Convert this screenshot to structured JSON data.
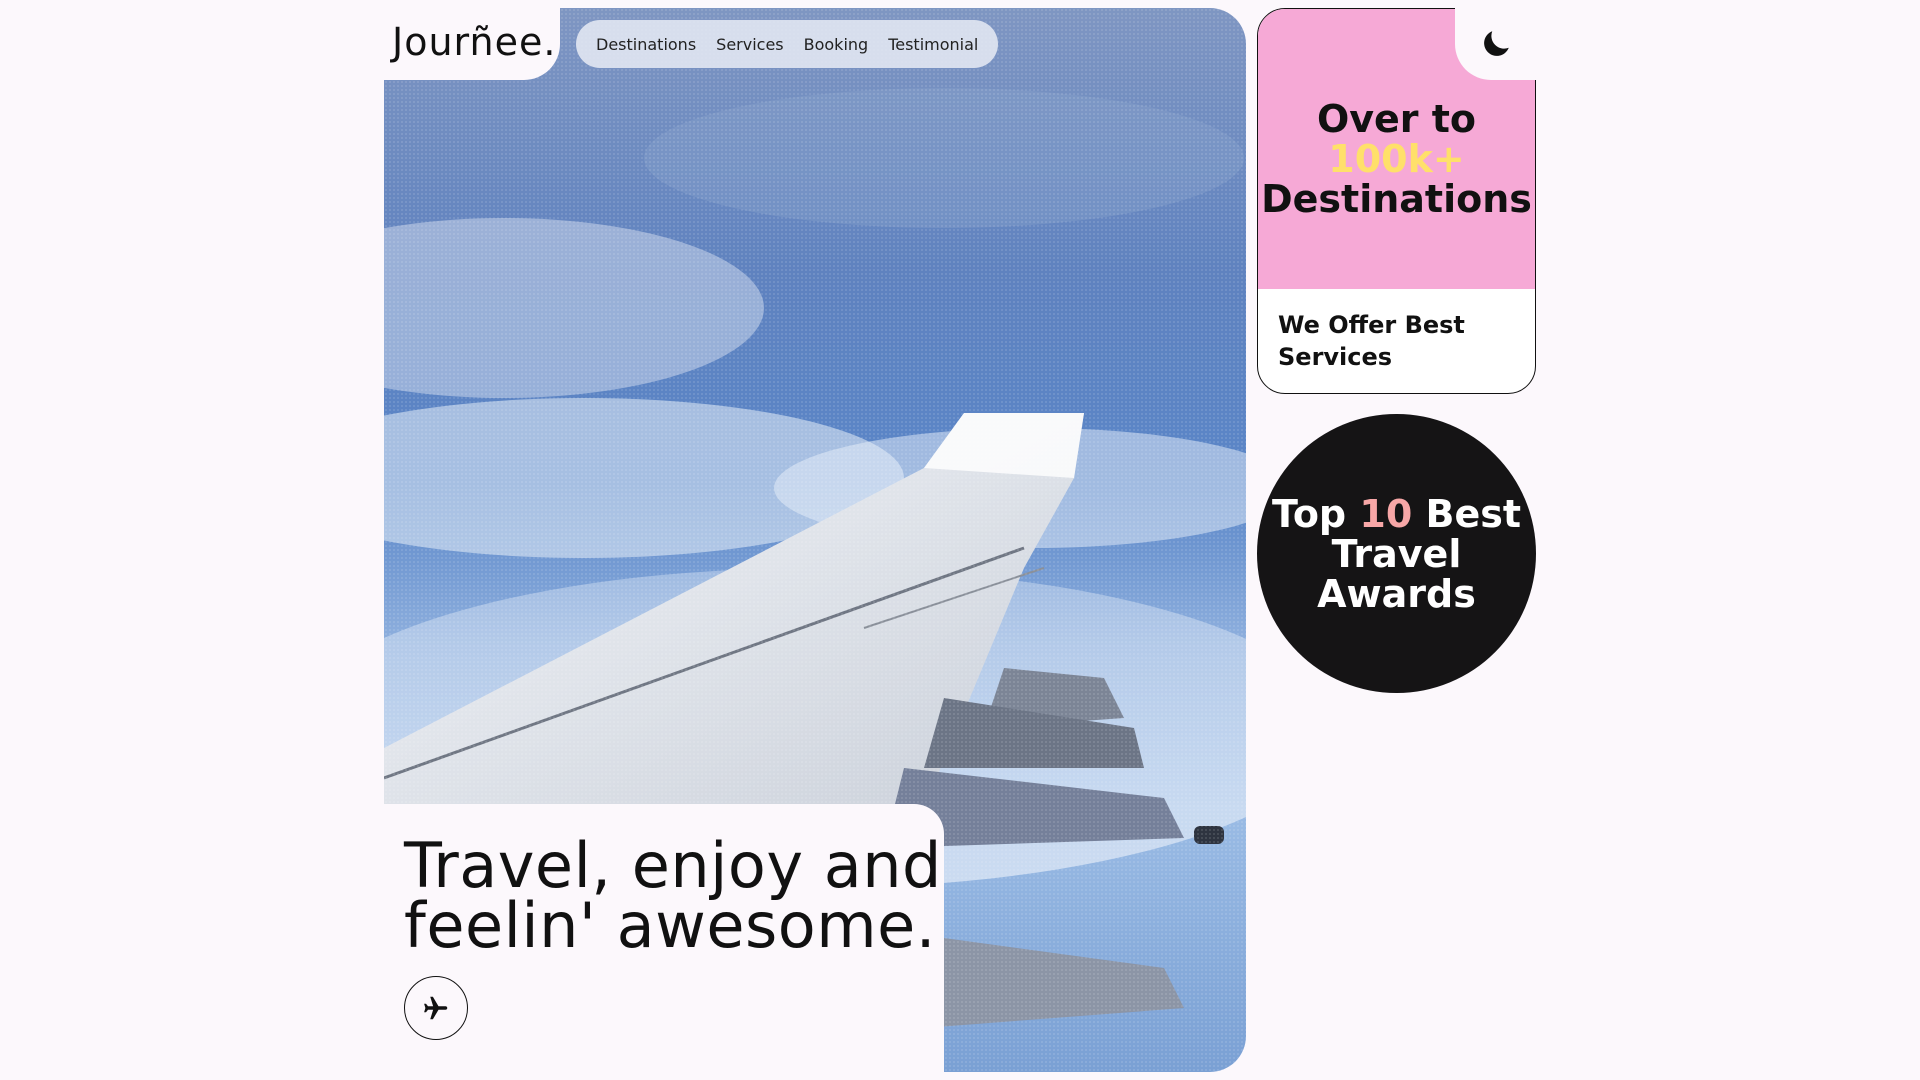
{
  "brand": {
    "name": "Jourñee."
  },
  "nav": {
    "items": [
      {
        "label": "Destinations"
      },
      {
        "label": "Services"
      },
      {
        "label": "Booking"
      },
      {
        "label": "Testimonial"
      }
    ]
  },
  "hero": {
    "headline_line1": "Travel, enjoy and",
    "headline_line2": "feelin' awesome.",
    "cta_icon": "airplane-icon"
  },
  "destinations_card": {
    "line1": "Over to",
    "highlight": "100k+",
    "line3": "Destinations",
    "subtitle": "We Offer Best Services",
    "colors": {
      "bg": "#f6a9d6",
      "highlight": "#ffe06a"
    }
  },
  "awards_card": {
    "prefix": "Top",
    "highlight": "10",
    "suffix": "Best",
    "line2": "Travel",
    "line3": "Awards",
    "colors": {
      "bg": "#151415",
      "highlight": "#f7a7a7"
    }
  },
  "theme_toggle": {
    "icon": "moon-icon"
  }
}
